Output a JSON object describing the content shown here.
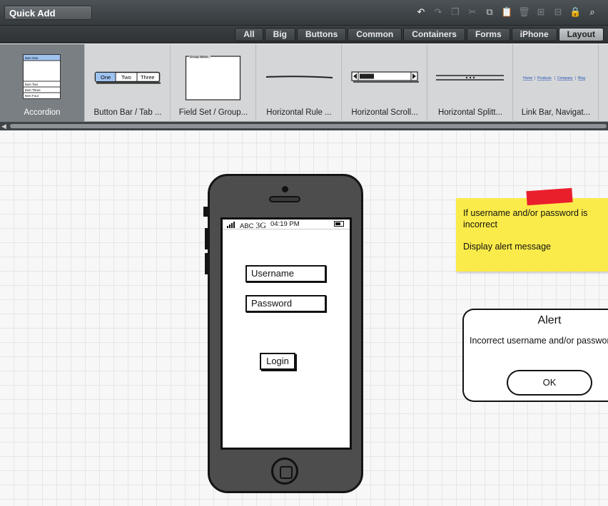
{
  "toolbar": {
    "quick_add": "Quick Add",
    "icons": [
      "undo-icon",
      "redo-icon",
      "copy-icon",
      "cut-icon",
      "duplicate-icon",
      "paste-icon",
      "delete-icon",
      "group-icon",
      "ungroup-icon",
      "lock-icon",
      "search-icon"
    ]
  },
  "categories": [
    "All",
    "Big",
    "Buttons",
    "Common",
    "Containers",
    "Forms",
    "iPhone",
    "Layout"
  ],
  "active_category": "Layout",
  "components": [
    {
      "label": "Accordion",
      "thumb": "accordion",
      "accordion_items": [
        "Item One",
        "Item Two",
        "Item Three",
        "Item Four"
      ]
    },
    {
      "label": "Button Bar / Tab ...",
      "thumb": "buttonbar",
      "buttons": [
        "One",
        "Two",
        "Three"
      ]
    },
    {
      "label": "Field Set / Group...",
      "thumb": "fieldset",
      "group_name": "Group Name"
    },
    {
      "label": "Horizontal Rule ...",
      "thumb": "hrule"
    },
    {
      "label": "Horizontal Scroll...",
      "thumb": "hscroll"
    },
    {
      "label": "Horizontal Splitt...",
      "thumb": "hsplit"
    },
    {
      "label": "Link Bar, Navigat...",
      "thumb": "linkbar",
      "links": [
        "Home",
        "Products",
        "Company",
        "Blog"
      ]
    }
  ],
  "phone": {
    "carrier": "ABC",
    "network": "3G",
    "time": "04:19 PM",
    "username_label": "Username",
    "password_label": "Password",
    "login_label": "Login"
  },
  "sticky_note": {
    "line1": "If username and/or password is incorrect",
    "line2": "Display alert message",
    "color": "#fbeb4a"
  },
  "alert": {
    "title": "Alert",
    "message": "Incorrect username and/or password",
    "ok_label": "OK"
  }
}
